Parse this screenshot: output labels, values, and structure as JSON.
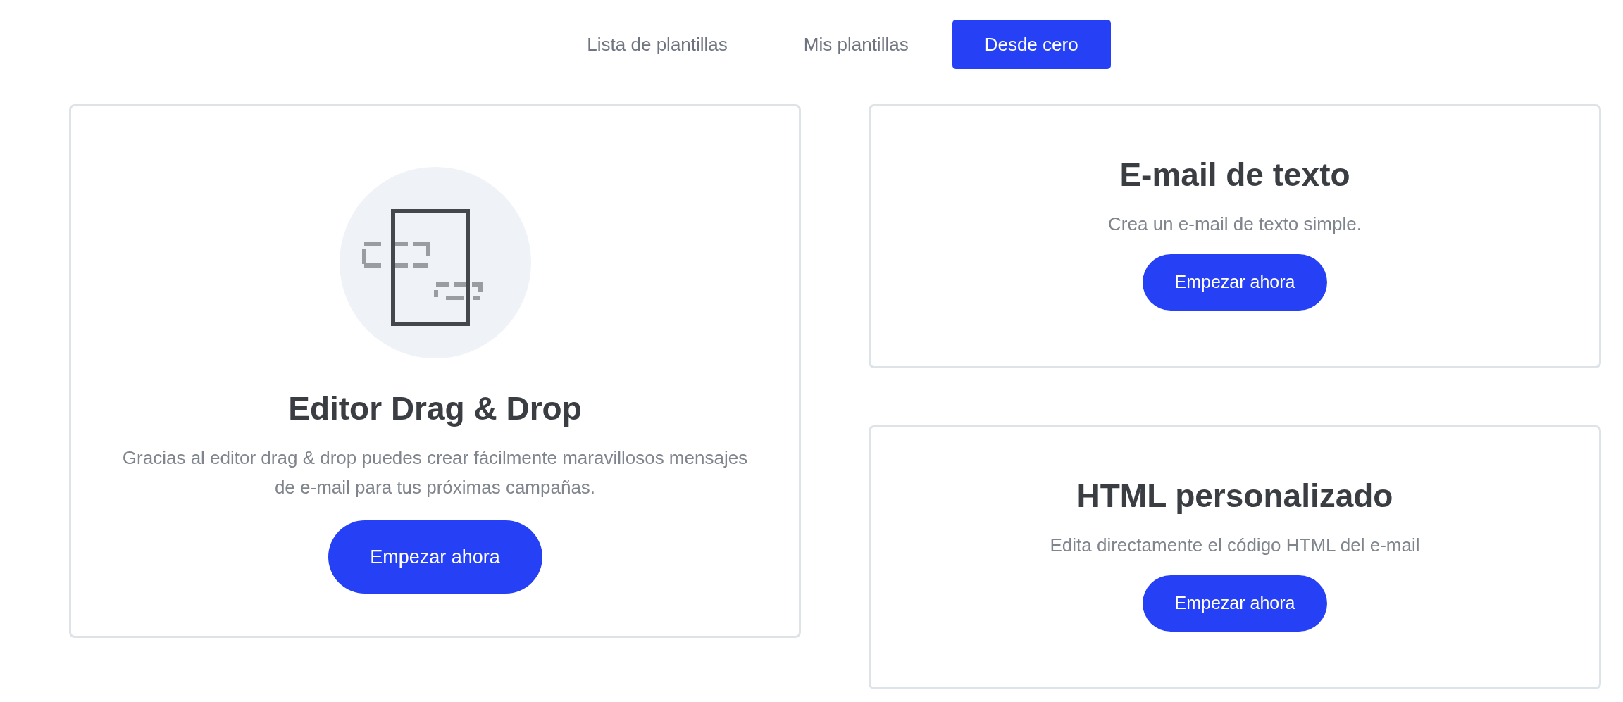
{
  "tabs": [
    {
      "label": "Lista de plantillas",
      "selected": false
    },
    {
      "label": "Mis plantillas",
      "selected": false
    },
    {
      "label": "Desde cero",
      "selected": true
    }
  ],
  "editors": [
    {
      "kind": "illustrated",
      "title": "Editor Drag & Drop",
      "description": "Gracias al editor drag & drop puedes crear fácilmente maravillosos mensajes de e-mail para tus próximas campañas.",
      "button": "Empezar ahora"
    },
    {
      "kind": "simple",
      "title": "E-mail de texto",
      "description": "Crea un e-mail de texto simple.",
      "button": "Empezar ahora"
    },
    {
      "kind": "simple",
      "title": "HTML personalizado",
      "description": "Edita directamente el código HTML del e-mail",
      "button": "Empezar ahora"
    }
  ]
}
